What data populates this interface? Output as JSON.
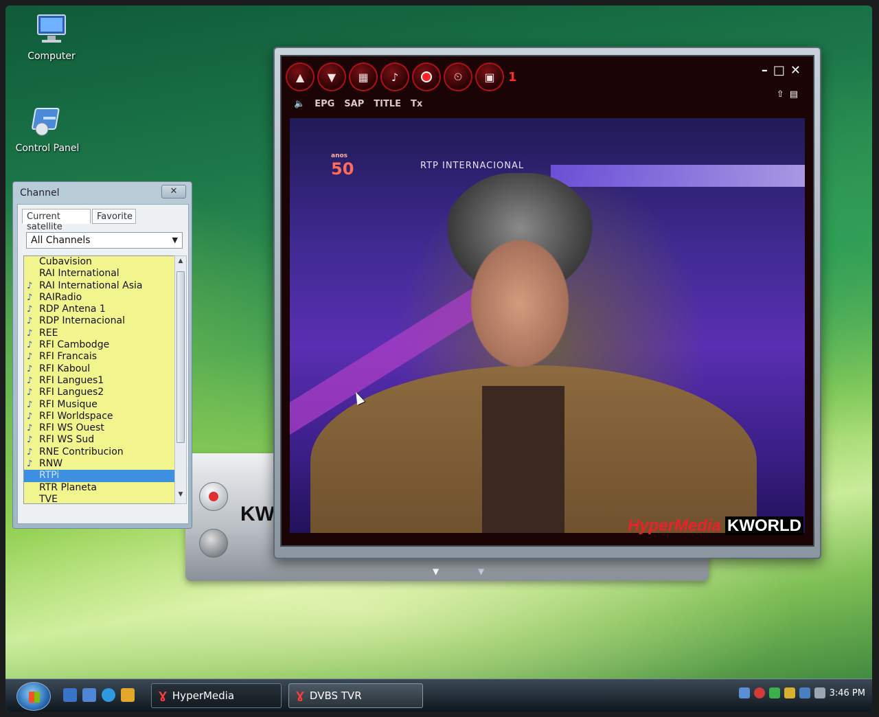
{
  "desktop": {
    "icons": [
      {
        "label": "Computer"
      },
      {
        "label": "Control Panel"
      }
    ]
  },
  "channel_panel": {
    "title": "Channel",
    "close_label": "✕",
    "tabs": [
      {
        "label": "Current satellite",
        "active": true
      },
      {
        "label": "Favorite",
        "active": false
      }
    ],
    "filter": {
      "selected": "All Channels"
    },
    "channels": [
      {
        "name": "Cubavision",
        "radio": false
      },
      {
        "name": "RAI International",
        "radio": false
      },
      {
        "name": "RAI International Asia",
        "radio": true
      },
      {
        "name": "RAIRadio",
        "radio": true
      },
      {
        "name": "RDP Antena 1",
        "radio": true
      },
      {
        "name": "RDP Internacional",
        "radio": true
      },
      {
        "name": "REE",
        "radio": true
      },
      {
        "name": "RFI Cambodge",
        "radio": true
      },
      {
        "name": "RFI Francais",
        "radio": true
      },
      {
        "name": "RFI Kaboul",
        "radio": true
      },
      {
        "name": "RFI Langues1",
        "radio": true
      },
      {
        "name": "RFI Langues2",
        "radio": true
      },
      {
        "name": "RFI Musique",
        "radio": true
      },
      {
        "name": "RFI Worldspace",
        "radio": true
      },
      {
        "name": "RFI WS Ouest",
        "radio": true
      },
      {
        "name": "RFI WS Sud",
        "radio": true
      },
      {
        "name": "RNE Contribucion",
        "radio": true
      },
      {
        "name": "RNW",
        "radio": true
      },
      {
        "name": "RTPi",
        "radio": false,
        "selected": true
      },
      {
        "name": "RTR Planeta",
        "radio": false
      },
      {
        "name": "TVE",
        "radio": false
      }
    ]
  },
  "player": {
    "toolbar": {
      "buttons": [
        {
          "name": "channel-up",
          "glyph": "▲"
        },
        {
          "name": "channel-down",
          "glyph": "▼"
        },
        {
          "name": "channel-grid",
          "glyph": "▦"
        },
        {
          "name": "audio",
          "glyph": "♪"
        },
        {
          "name": "record",
          "glyph": ""
        },
        {
          "name": "schedule",
          "glyph": "⏲"
        },
        {
          "name": "capture",
          "glyph": "▣"
        }
      ],
      "channel_number": "1"
    },
    "subbar": [
      "EPG",
      "SAP",
      "TITLE",
      "Tx"
    ],
    "window_controls": [
      "–",
      "□",
      "✕"
    ],
    "window_controls2": [
      "⇧",
      "▤"
    ],
    "video": {
      "logo_top": "anos",
      "logo_main": "50",
      "channel_bug": "RTP INTERNACIONAL"
    },
    "brand": {
      "hypermedia": "HyperMedia",
      "kworld": "KWORLD"
    },
    "base_logo": "KW"
  },
  "taskbar": {
    "buttons": [
      {
        "label": "HyperMedia"
      },
      {
        "label": "DVBS TVR"
      }
    ],
    "clock": "3:46 PM"
  }
}
